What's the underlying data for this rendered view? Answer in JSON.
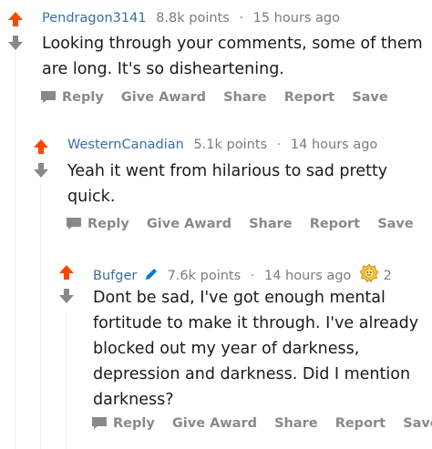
{
  "colors": {
    "upvote": "#ff4500",
    "downvote": "#878a8c",
    "author": "#3a6ea5",
    "meta": "#7c7c7c",
    "action": "#878a8c",
    "award": "#f5c542"
  },
  "actions": {
    "reply": "Reply",
    "give_award": "Give Award",
    "share": "Share",
    "report": "Report",
    "save": "Save"
  },
  "comments": [
    {
      "author": "Pendragon3141",
      "points": "8.8k points",
      "time": "15 hours ago",
      "body": "Looking through your comments, some of them are long. It's so disheartening."
    },
    {
      "author": "WesternCanadian",
      "points": "5.1k points",
      "time": "14 hours ago",
      "body": "Yeah it went from hilarious to sad pretty quick."
    },
    {
      "author": "Bufger",
      "points": "7.6k points",
      "time": "14 hours ago",
      "award_count": "2",
      "icons": [
        "pencil-icon",
        "award-icon"
      ],
      "body": "Dont be sad, I've got enough mental fortitude to make it through. I've already blocked out my year of darkness, depression and darkness. Did I mention darkness?"
    }
  ],
  "separator": "·"
}
